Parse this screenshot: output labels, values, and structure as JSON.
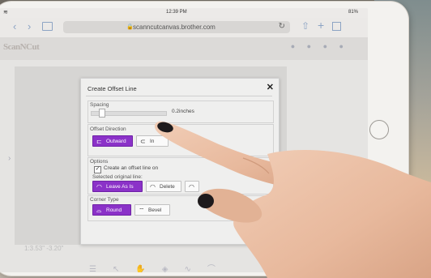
{
  "status": {
    "time": "12:39 PM",
    "battery": "81%"
  },
  "browser": {
    "url": "scanncutcanvas.brother.com"
  },
  "app": {
    "logo": "ScanNCut",
    "readout": "1:3.53\"  -3.20\""
  },
  "dialog": {
    "title": "Create Offset Line",
    "spacing_label": "Spacing",
    "spacing_value": "0.2inches",
    "offset_direction_label": "Offset Direction",
    "outward_label": "Outward",
    "inward_label": "In",
    "options_label": "Options",
    "create_offset_label": "Create an offset line on",
    "selected_original_label": "Selected original line:",
    "leave_as_is_label": "Leave As Is",
    "delete_label": "Delete",
    "corner_type_label": "Corner Type",
    "round_label": "Round",
    "bevel_label": "Bevel"
  },
  "colors": {
    "accent": "#8b32c8"
  }
}
